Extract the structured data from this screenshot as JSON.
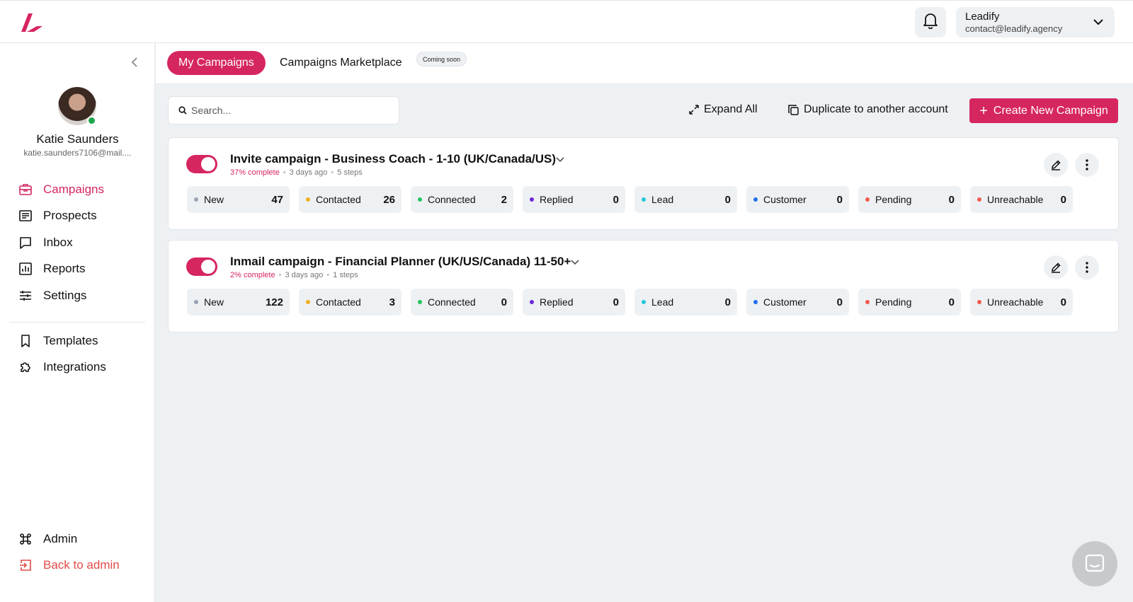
{
  "header": {
    "account_name": "Leadify",
    "account_email": "contact@leadify.agency"
  },
  "user": {
    "name": "Katie Saunders",
    "email": "katie.saunders7106@mail...."
  },
  "nav": {
    "campaigns": "Campaigns",
    "prospects": "Prospects",
    "inbox": "Inbox",
    "reports": "Reports",
    "settings": "Settings",
    "templates": "Templates",
    "integrations": "Integrations",
    "admin": "Admin",
    "back_to_admin": "Back to admin"
  },
  "tabs": {
    "my_campaigns": "My Campaigns",
    "marketplace": "Campaigns Marketplace",
    "coming_soon": "Coming soon"
  },
  "toolbar": {
    "search_placeholder": "Search...",
    "expand_all": "Expand All",
    "duplicate": "Duplicate to another account",
    "create": "Create New Campaign"
  },
  "colors": {
    "accent": "#d6265f",
    "new": "#9aa3b2",
    "contacted": "#f2b01e",
    "connected": "#22c55e",
    "replied": "#6d28d9",
    "lead": "#22c7d6",
    "customer": "#1f6feb",
    "pending": "#ef5a4a",
    "unreachable": "#ef5a4a"
  },
  "campaigns": [
    {
      "title": "Invite campaign - Business Coach - 1-10 (UK/Canada/US)",
      "complete": "37% complete",
      "age": "3 days ago",
      "steps": "5 steps",
      "stats": [
        {
          "label": "New",
          "value": "47"
        },
        {
          "label": "Contacted",
          "value": "26"
        },
        {
          "label": "Connected",
          "value": "2"
        },
        {
          "label": "Replied",
          "value": "0"
        },
        {
          "label": "Lead",
          "value": "0"
        },
        {
          "label": "Customer",
          "value": "0"
        },
        {
          "label": "Pending",
          "value": "0"
        },
        {
          "label": "Unreachable",
          "value": "0"
        }
      ]
    },
    {
      "title": "Inmail campaign - Financial Planner (UK/US/Canada) 11-50+",
      "complete": "2% complete",
      "age": "3 days ago",
      "steps": "1 steps",
      "stats": [
        {
          "label": "New",
          "value": "122"
        },
        {
          "label": "Contacted",
          "value": "3"
        },
        {
          "label": "Connected",
          "value": "0"
        },
        {
          "label": "Replied",
          "value": "0"
        },
        {
          "label": "Lead",
          "value": "0"
        },
        {
          "label": "Customer",
          "value": "0"
        },
        {
          "label": "Pending",
          "value": "0"
        },
        {
          "label": "Unreachable",
          "value": "0"
        }
      ]
    }
  ]
}
